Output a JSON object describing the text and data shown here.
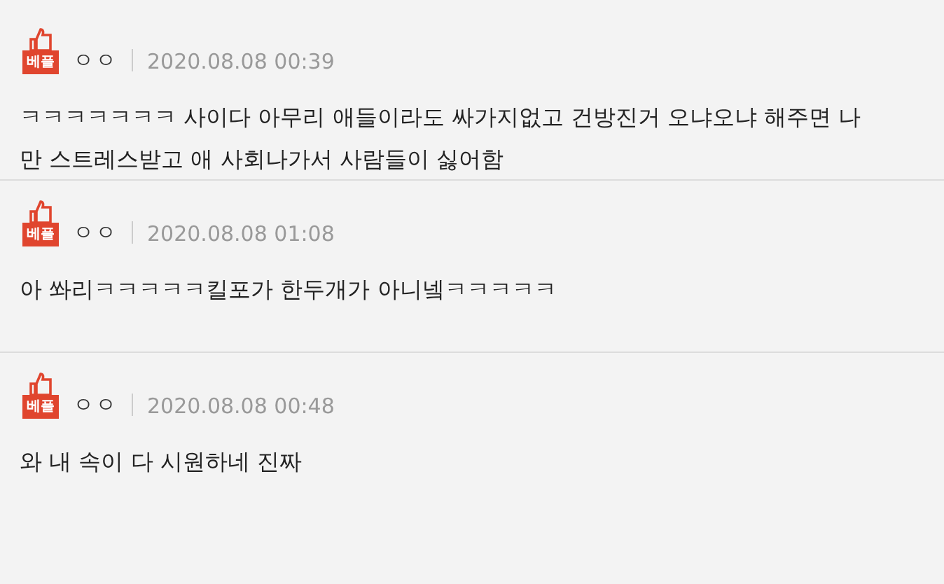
{
  "comments": [
    {
      "badge": "베플",
      "author": "ㅇㅇ",
      "date": "2020.08.08 00:39",
      "text": "ㅋㅋㅋㅋㅋㅋㅋ 사이다 아무리 애들이라도 싸가지없고 건방진거 오냐오냐 해주면 나만 스트레스받고 애 사회나가서 사람들이 싫어함"
    },
    {
      "badge": "베플",
      "author": "ㅇㅇ",
      "date": "2020.08.08 01:08",
      "text": "아 쏴리ㅋㅋㅋㅋㅋ킬포가 한두개가 아니넼ㅋㅋㅋㅋㅋ"
    },
    {
      "badge": "베플",
      "author": "ㅇㅇ",
      "date": "2020.08.08 00:48",
      "text": "와 내 속이 다 시원하네 진짜"
    }
  ]
}
